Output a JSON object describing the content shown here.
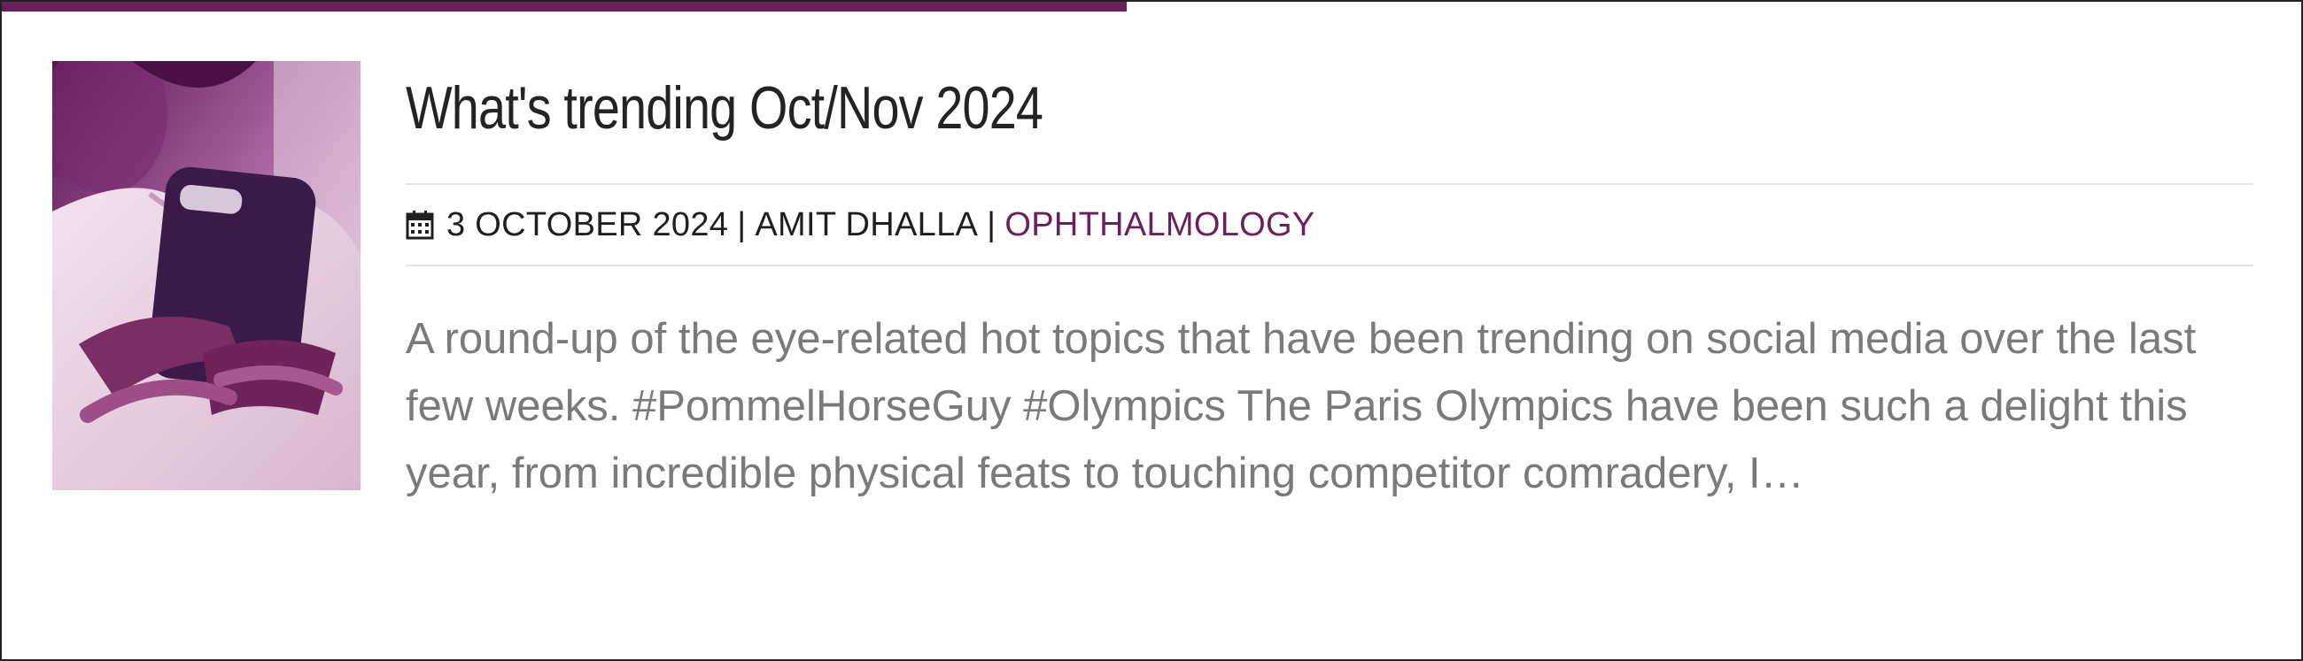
{
  "post": {
    "title": "What's trending Oct/Nov 2024",
    "date": "3 OCTOBER 2024",
    "author": "AMIT DHALLA",
    "category": "OPHTHALMOLOGY",
    "separator": "|",
    "excerpt": "A round-up of the eye-related hot topics that have been trending on social media over the last few weeks. #PommelHorseGuy #Olympics The Paris Olympics have been such a delight this year, from incredible physical feats to touching competitor comradery, I…",
    "thumbnail_icon": "person-with-smartphone-image"
  },
  "colors": {
    "accent": "#6b1f5c",
    "title": "#232323",
    "meta": "#1f1f1f",
    "excerpt": "#7a7a7a",
    "rule": "#e6e6e6"
  },
  "icons": {
    "date": "calendar-icon"
  }
}
